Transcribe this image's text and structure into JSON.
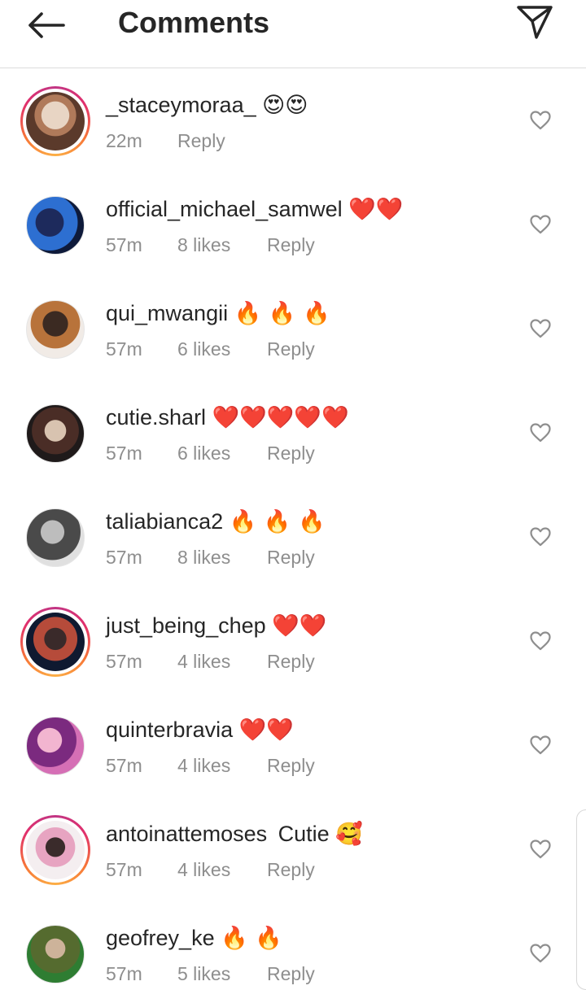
{
  "header": {
    "title": "Comments",
    "back_icon": "arrow-left-icon",
    "send_icon": "paper-plane-icon"
  },
  "colors": {
    "story_ring": "#e1306c",
    "text": "#262626",
    "meta": "#8e8e8e"
  },
  "comments": [
    {
      "username": "_staceymoraa_",
      "text": "",
      "emoji": "😍😍",
      "time": "22m",
      "likes": "",
      "reply": "Reply",
      "story": true
    },
    {
      "username": "official_michael_samwel",
      "text": "",
      "emoji": "❤️❤️",
      "time": "57m",
      "likes": "8 likes",
      "reply": "Reply",
      "story": false
    },
    {
      "username": "qui_mwangii",
      "text": "",
      "emoji": "🔥 🔥 🔥",
      "time": "57m",
      "likes": "6 likes",
      "reply": "Reply",
      "story": false
    },
    {
      "username": "cutie.sharl",
      "text": "",
      "emoji": "❤️❤️❤️❤️❤️",
      "time": "57m",
      "likes": "6 likes",
      "reply": "Reply",
      "story": false
    },
    {
      "username": "taliabianca2",
      "text": "",
      "emoji": "🔥 🔥 🔥",
      "time": "57m",
      "likes": "8 likes",
      "reply": "Reply",
      "story": false
    },
    {
      "username": "just_being_chep",
      "text": "",
      "emoji": "❤️❤️",
      "time": "57m",
      "likes": "4 likes",
      "reply": "Reply",
      "story": true
    },
    {
      "username": "quinterbravia",
      "text": "",
      "emoji": "❤️❤️",
      "time": "57m",
      "likes": "4 likes",
      "reply": "Reply",
      "story": false
    },
    {
      "username": "antoinattemoses",
      "text": "Cutie",
      "emoji": "🥰",
      "time": "57m",
      "likes": "4 likes",
      "reply": "Reply",
      "story": true
    },
    {
      "username": "geofrey_ke",
      "text": "",
      "emoji": "🔥 🔥",
      "time": "57m",
      "likes": "5 likes",
      "reply": "Reply",
      "story": false
    }
  ]
}
